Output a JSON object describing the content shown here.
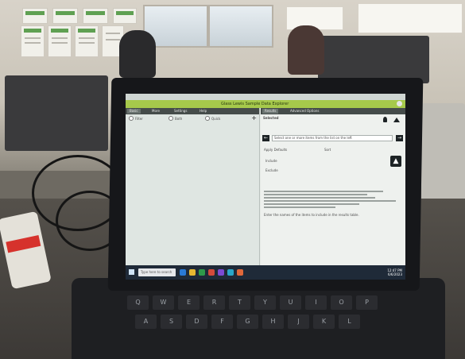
{
  "app": {
    "title": "Glass Lewis Sample Data Explorer"
  },
  "left_pane": {
    "tabs": [
      "Basic",
      "More",
      "Settings",
      "Help"
    ],
    "radio_options": [
      "Filter",
      "Both",
      "Quick"
    ]
  },
  "right_pane": {
    "tabs": [
      "Results",
      "Advanced Options"
    ],
    "header_text": "Selected",
    "field_value": "Select one or more items from the list on the left",
    "option_a": "Apply Defaults",
    "option_b": "Sort",
    "checkbox_a": "Include",
    "checkbox_b": "Exclude",
    "note": "Enter the names of the items to include in the results table."
  },
  "taskbar": {
    "search_placeholder": "Type here to search",
    "time": "12:47 PM",
    "date": "6/6/2023"
  },
  "icons": {
    "thumbs_up": "thumbs-up-icon",
    "add": "plus-icon",
    "left_arrow": "arrow-left-icon",
    "right_arrow": "arrow-right-icon"
  },
  "colors": {
    "title_bar": "#a6c94b",
    "pane_header": "#454c4a",
    "taskbar": "#1f2a38"
  }
}
